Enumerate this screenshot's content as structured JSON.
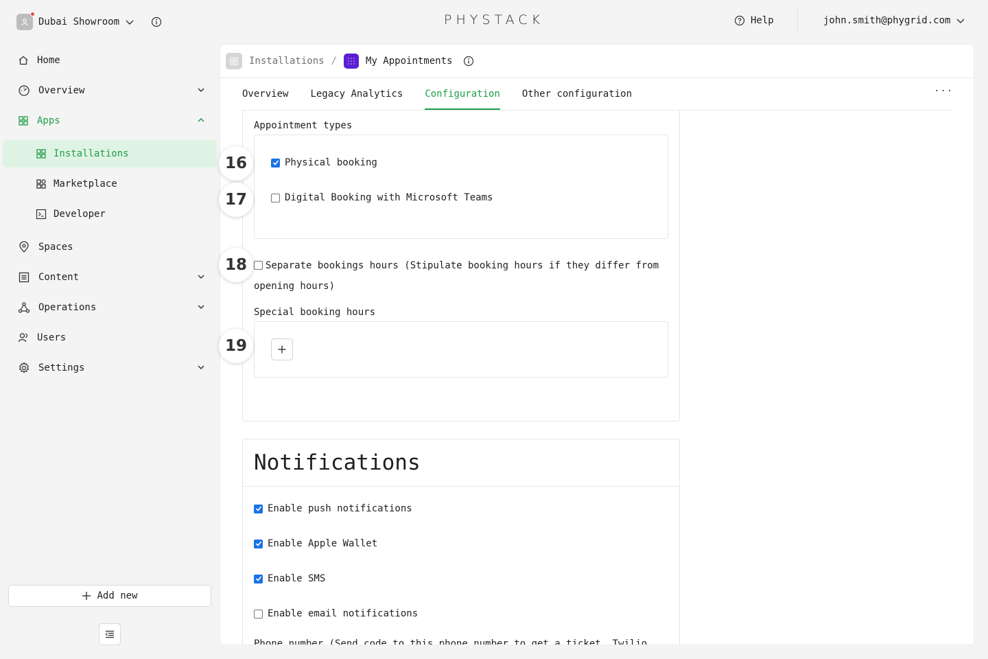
{
  "topbar": {
    "org_name": "Dubai Showroom",
    "logo": "PHYSTACK",
    "help_label": "Help",
    "user_email": "john.smith@phygrid.com"
  },
  "sidebar": {
    "items": [
      {
        "label": "Home",
        "icon": "home-icon"
      },
      {
        "label": "Overview",
        "icon": "dashboard-icon"
      },
      {
        "label": "Apps",
        "icon": "apps-icon"
      },
      {
        "label": "Installations",
        "icon": "grid-icon"
      },
      {
        "label": "Marketplace",
        "icon": "marketplace-icon"
      },
      {
        "label": "Developer",
        "icon": "terminal-icon"
      },
      {
        "label": "Spaces",
        "icon": "location-icon"
      },
      {
        "label": "Content",
        "icon": "content-icon"
      },
      {
        "label": "Operations",
        "icon": "operations-icon"
      },
      {
        "label": "Users",
        "icon": "users-icon"
      },
      {
        "label": "Settings",
        "icon": "gear-icon"
      }
    ],
    "add_new_label": "Add new"
  },
  "breadcrumb": {
    "parent": "Installations",
    "separator": "/",
    "current": "My Appointments"
  },
  "tabs": [
    "Overview",
    "Legacy Analytics",
    "Configuration",
    "Other configuration"
  ],
  "active_tab": "Configuration",
  "more_label": "···",
  "booking": {
    "appointment_types_label": "Appointment types",
    "physical_booking": {
      "label": "Physical booking",
      "checked": true
    },
    "digital_booking": {
      "label": "Digital Booking with Microsoft Teams",
      "checked": false
    },
    "separate_hours": {
      "label": "Separate bookings hours (Stipulate booking hours if they differ from",
      "label_cont": "opening hours)",
      "checked": false
    },
    "special_hours_label": "Special booking hours",
    "add_label": "+"
  },
  "notifications": {
    "title": "Notifications",
    "push": {
      "label": "Enable push notifications",
      "checked": true
    },
    "wallet": {
      "label": "Enable Apple Wallet",
      "checked": true
    },
    "sms": {
      "label": "Enable SMS",
      "checked": true
    },
    "email": {
      "label": "Enable email notifications",
      "checked": false
    },
    "phone_label": "Phone number (Send code to this phone number to get a ticket. Twilio"
  },
  "annotations": [
    "16",
    "17",
    "18",
    "19"
  ],
  "colors": {
    "accent": "#1f9d48",
    "active_bg": "#dff3e4",
    "checkbox": "#1a73e8",
    "app_icon": "#5b1fd1"
  }
}
